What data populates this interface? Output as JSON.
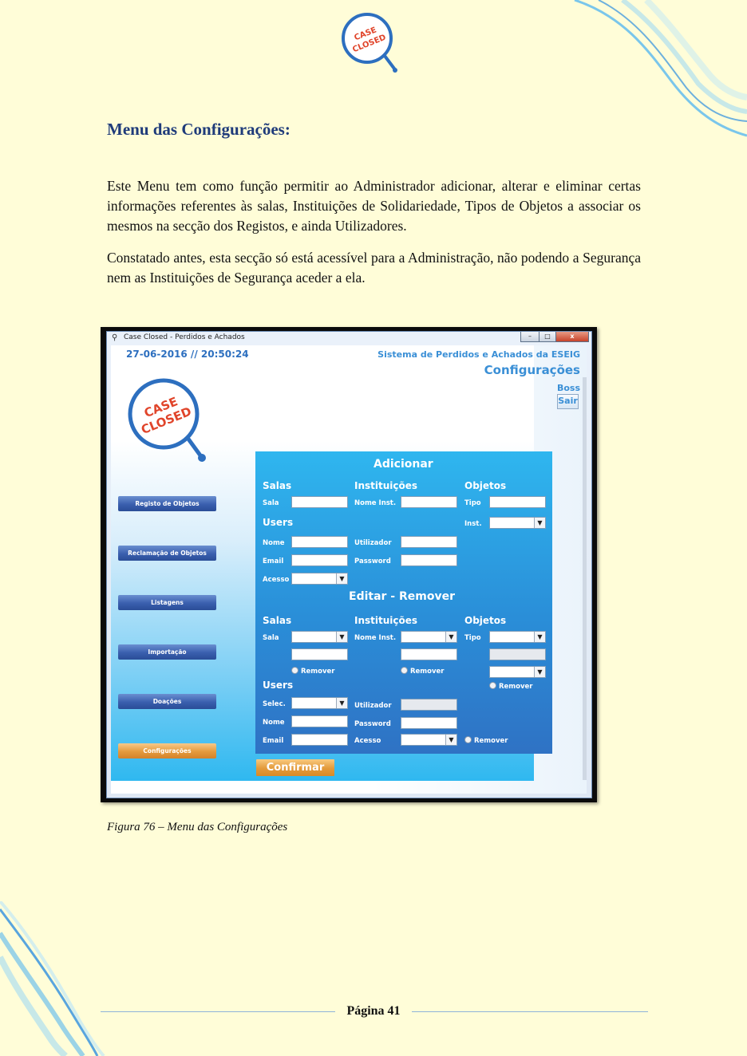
{
  "document": {
    "section_title": "Menu das Configurações:",
    "paragraphs": [
      "Este Menu tem como função permitir ao Administrador adicionar, alterar e eliminar certas informações referentes às salas, Instituições de Solidariedade, Tipos de Objetos a associar os mesmos na secção dos Registos, e ainda Utilizadores.",
      "Constatado antes, esta secção só está acessível para a Administração, não podendo a Segurança nem as Instituições de Segurança aceder a ela."
    ],
    "figure_caption": "Figura 76 – Menu das Configurações",
    "page_number": "Página 41",
    "logo_text": [
      "CASE",
      "CLOSED"
    ]
  },
  "app": {
    "window_title": "Case Closed - Perdidos e Achados",
    "window_icon": "magnifier-icon",
    "datetime": "27-06-2016 // 20:50:24",
    "system_title": "Sistema de Perdidos e Achados da ESEIG",
    "screen_title": "Configurações",
    "user": "Boss",
    "exit_label": "Sair",
    "logo_text": [
      "CASE",
      "CLOSED"
    ],
    "sidebar": [
      {
        "label": "Registo de Objetos",
        "active": false
      },
      {
        "label": "Reclamação de Objetos",
        "active": false
      },
      {
        "label": "Listagens",
        "active": false
      },
      {
        "label": "Importação",
        "active": false
      },
      {
        "label": "Doações",
        "active": false
      },
      {
        "label": "Configurações",
        "active": true
      }
    ],
    "add": {
      "heading": "Adicionar",
      "salas": {
        "title": "Salas",
        "sala_label": "Sala"
      },
      "instituicoes": {
        "title": "Instituições",
        "nome_label": "Nome Inst."
      },
      "objetos": {
        "title": "Objetos",
        "tipo_label": "Tipo",
        "inst_label": "Inst."
      },
      "users": {
        "title": "Users",
        "nome_label": "Nome",
        "email_label": "Email",
        "acesso_label": "Acesso",
        "utilizador_label": "Utilizador",
        "password_label": "Password"
      }
    },
    "edit": {
      "heading": "Editar - Remover",
      "salas": {
        "title": "Salas",
        "sala_label": "Sala",
        "remove_label": "Remover"
      },
      "instituicoes": {
        "title": "Instituições",
        "nome_label": "Nome Inst.",
        "remove_label": "Remover"
      },
      "objetos": {
        "title": "Objetos",
        "tipo_label": "Tipo",
        "remove_label": "Remover"
      },
      "users": {
        "title": "Users",
        "selec_label": "Selec.",
        "nome_label": "Nome",
        "email_label": "Email",
        "utilizador_label": "Utilizador",
        "password_label": "Password",
        "acesso_label": "Acesso",
        "remove_label": "Remover"
      }
    },
    "confirm_label": "Confirmar",
    "colors": {
      "panel": "#2a8ed8",
      "accent_text": "#3a8fd6",
      "button_blue": "#3a5fae",
      "button_orange": "#e49a3c"
    }
  }
}
